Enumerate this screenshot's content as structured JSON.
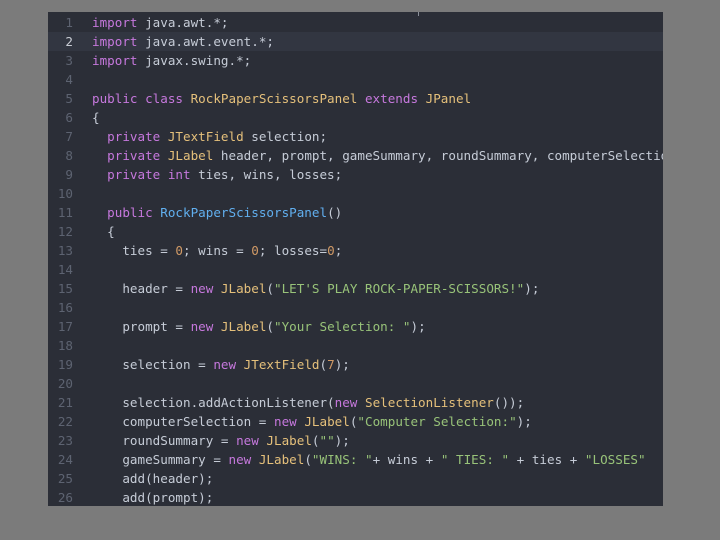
{
  "editor": {
    "active_line": 2,
    "colors": {
      "background": "#2b2e37",
      "keyword": "#c678dd",
      "class": "#e5c07b",
      "function": "#61afef",
      "string": "#98c379",
      "number": "#d19a66",
      "text": "#c6ccd7",
      "gutter": "#5d6371"
    },
    "lines": [
      {
        "n": "1",
        "tokens": [
          [
            "kw",
            "import"
          ],
          [
            "txt",
            " java.awt.*;"
          ]
        ]
      },
      {
        "n": "2",
        "tokens": [
          [
            "kw",
            "import"
          ],
          [
            "txt",
            " java.awt.event.*;"
          ]
        ]
      },
      {
        "n": "3",
        "tokens": [
          [
            "kw",
            "import"
          ],
          [
            "txt",
            " javax.swing.*;"
          ]
        ]
      },
      {
        "n": "4",
        "tokens": []
      },
      {
        "n": "5",
        "tokens": [
          [
            "kw",
            "public class "
          ],
          [
            "cls",
            "RockPaperScissorsPanel"
          ],
          [
            "kw",
            " extends "
          ],
          [
            "cls",
            "JPanel"
          ]
        ]
      },
      {
        "n": "6",
        "tokens": [
          [
            "txt",
            "{"
          ]
        ]
      },
      {
        "n": "7",
        "tokens": [
          [
            "kw",
            "  private "
          ],
          [
            "cls",
            "JTextField"
          ],
          [
            "txt",
            " selection;"
          ]
        ]
      },
      {
        "n": "8",
        "tokens": [
          [
            "kw",
            "  private "
          ],
          [
            "cls",
            "JLabel"
          ],
          [
            "txt",
            " header, prompt, gameSummary, roundSummary, computerSelection;"
          ]
        ]
      },
      {
        "n": "9",
        "tokens": [
          [
            "kw",
            "  private int"
          ],
          [
            "txt",
            " ties, wins, losses;"
          ]
        ]
      },
      {
        "n": "10",
        "tokens": []
      },
      {
        "n": "11",
        "tokens": [
          [
            "kw",
            "  public "
          ],
          [
            "fn",
            "RockPaperScissorsPanel"
          ],
          [
            "txt",
            "()"
          ]
        ]
      },
      {
        "n": "12",
        "tokens": [
          [
            "txt",
            "  {"
          ]
        ]
      },
      {
        "n": "13",
        "tokens": [
          [
            "txt",
            "    ties = "
          ],
          [
            "num",
            "0"
          ],
          [
            "txt",
            "; wins = "
          ],
          [
            "num",
            "0"
          ],
          [
            "txt",
            "; losses="
          ],
          [
            "num",
            "0"
          ],
          [
            "txt",
            ";"
          ]
        ]
      },
      {
        "n": "14",
        "tokens": []
      },
      {
        "n": "15",
        "tokens": [
          [
            "txt",
            "    header = "
          ],
          [
            "kw",
            "new "
          ],
          [
            "cls",
            "JLabel"
          ],
          [
            "txt",
            "("
          ],
          [
            "str",
            "\"LET'S PLAY ROCK-PAPER-SCISSORS!\""
          ],
          [
            "txt",
            ");"
          ]
        ]
      },
      {
        "n": "16",
        "tokens": []
      },
      {
        "n": "17",
        "tokens": [
          [
            "txt",
            "    prompt = "
          ],
          [
            "kw",
            "new "
          ],
          [
            "cls",
            "JLabel"
          ],
          [
            "txt",
            "("
          ],
          [
            "str",
            "\"Your Selection: \""
          ],
          [
            "txt",
            ");"
          ]
        ]
      },
      {
        "n": "18",
        "tokens": []
      },
      {
        "n": "19",
        "tokens": [
          [
            "txt",
            "    selection = "
          ],
          [
            "kw",
            "new "
          ],
          [
            "cls",
            "JTextField"
          ],
          [
            "txt",
            "("
          ],
          [
            "num",
            "7"
          ],
          [
            "txt",
            ");"
          ]
        ]
      },
      {
        "n": "20",
        "tokens": []
      },
      {
        "n": "21",
        "tokens": [
          [
            "txt",
            "    selection.addActionListener("
          ],
          [
            "kw",
            "new "
          ],
          [
            "cls",
            "SelectionListener"
          ],
          [
            "txt",
            "());"
          ]
        ]
      },
      {
        "n": "22",
        "tokens": [
          [
            "txt",
            "    computerSelection = "
          ],
          [
            "kw",
            "new "
          ],
          [
            "cls",
            "JLabel"
          ],
          [
            "txt",
            "("
          ],
          [
            "str",
            "\"Computer Selection:\""
          ],
          [
            "txt",
            ");"
          ]
        ]
      },
      {
        "n": "23",
        "tokens": [
          [
            "txt",
            "    roundSummary = "
          ],
          [
            "kw",
            "new "
          ],
          [
            "cls",
            "JLabel"
          ],
          [
            "txt",
            "("
          ],
          [
            "str",
            "\"\""
          ],
          [
            "txt",
            ");"
          ]
        ]
      },
      {
        "n": "24",
        "tokens": [
          [
            "txt",
            "    gameSummary = "
          ],
          [
            "kw",
            "new "
          ],
          [
            "cls",
            "JLabel"
          ],
          [
            "txt",
            "("
          ],
          [
            "str",
            "\"WINS: \""
          ],
          [
            "txt",
            "+ wins + "
          ],
          [
            "str",
            "\" TIES: \""
          ],
          [
            "txt",
            " + ties + "
          ],
          [
            "str",
            "\"LOSSES\""
          ]
        ]
      },
      {
        "n": "25",
        "tokens": [
          [
            "txt",
            "    add(header);"
          ]
        ]
      },
      {
        "n": "26",
        "tokens": [
          [
            "txt",
            "    add(prompt);"
          ]
        ]
      }
    ]
  }
}
